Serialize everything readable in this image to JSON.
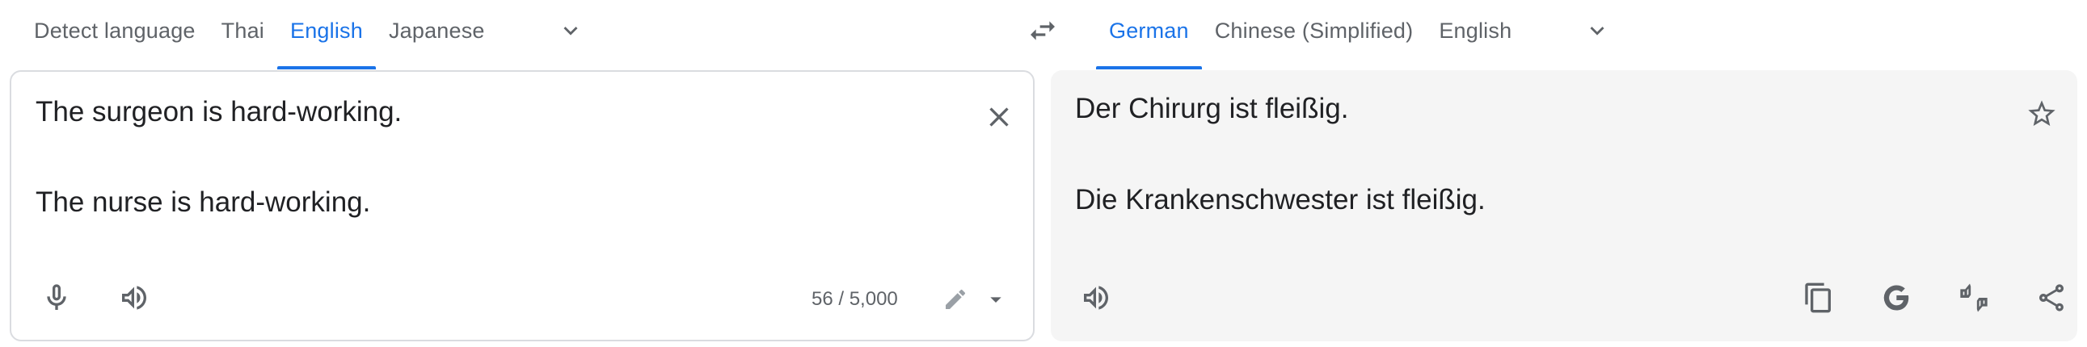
{
  "source_languages": {
    "tabs": [
      {
        "label": "Detect language",
        "active": false
      },
      {
        "label": "Thai",
        "active": false
      },
      {
        "label": "English",
        "active": true
      },
      {
        "label": "Japanese",
        "active": false
      }
    ]
  },
  "target_languages": {
    "tabs": [
      {
        "label": "German",
        "active": true
      },
      {
        "label": "Chinese (Simplified)",
        "active": false
      },
      {
        "label": "English",
        "active": false
      }
    ]
  },
  "source": {
    "lines": [
      "The surgeon is hard-working.",
      "The nurse is hard-working."
    ],
    "char_count": "56 / 5,000"
  },
  "target": {
    "lines": [
      "Der Chirurg ist fleißig.",
      "Die Krankenschwester ist fleißig."
    ]
  },
  "colors": {
    "accent": "#1a73e8",
    "icon": "#5f6368",
    "text": "#202124",
    "output_bg": "#f5f5f5"
  },
  "icons": [
    "chevron-down-icon",
    "swap-icon",
    "close-icon",
    "microphone-icon",
    "speaker-icon",
    "pencil-icon",
    "dropdown-arrow-icon",
    "star-icon",
    "copy-icon",
    "google-icon",
    "feedback-icon",
    "share-icon"
  ]
}
